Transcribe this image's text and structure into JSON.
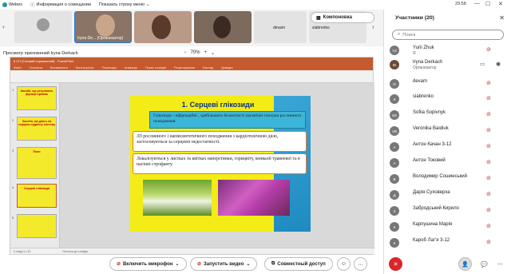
{
  "app": {
    "name": "Webex",
    "info_label": "Информация о совещании",
    "ticker_label": "Показать строку меню",
    "time": "29:58"
  },
  "strip": {
    "tiles": [
      {
        "name": ""
      },
      {
        "name": "Iryna De... (Организатор)"
      },
      {
        "name": ""
      },
      {
        "name": ""
      },
      {
        "name": "devam"
      },
      {
        "name": "siabrenko"
      }
    ]
  },
  "viewer": {
    "title": "Просмотр приложений Iryna Derkach",
    "zoom": "70%",
    "layout_button": "Компоновка"
  },
  "ppt": {
    "window_title": "6 СП (Готовий нормальний) - PowerPoint",
    "tabs": [
      "Файл",
      "Основна",
      "Вставлення",
      "Конструктор",
      "Переходи",
      "Анімація",
      "Показ слайдів",
      "Рецензування",
      "Вигляд",
      "Довідка"
    ],
    "status_left": "Слайд 4 з 12",
    "status_notes": "Нотатки до слайда",
    "thumbs": [
      {
        "num": "1",
        "text": "Засоби, що регулюють функції органів"
      },
      {
        "num": "2",
        "text": "Засоби, які діють на серцево-судинну систему"
      },
      {
        "num": "3",
        "text": "План"
      },
      {
        "num": "4",
        "text": "Серцеві глікозиди"
      },
      {
        "num": "5",
        "text": ""
      }
    ],
    "slide": {
      "title": "1. Серцеві глікозиди",
      "box1": "Глікозиди – ефірподібні , здебільшого безазотисті органічні сполуки рослинного походження",
      "box2": "ЛЗ рослинного і напівсинтетичного походження з кардіотонічною дією, застосовуються за серцевої недостатності.",
      "box3": "Локалізуються у листках та квітках наперстянки, горицвіту, конвалії травневої та в насінні строфанту."
    }
  },
  "participants": {
    "title": "Участники (20)",
    "search_placeholder": "Поиск",
    "list": [
      {
        "initials": "YZ",
        "name": "Yurii Zhuk",
        "role": "Я"
      },
      {
        "initials": "ID",
        "name": "Iryna Derkach",
        "role": "Организатор"
      },
      {
        "initials": "D",
        "name": "devam",
        "role": ""
      },
      {
        "initials": "S",
        "name": "siabrenko",
        "role": ""
      },
      {
        "initials": "SS",
        "name": "Sofiia Sopivnyk",
        "role": ""
      },
      {
        "initials": "VB",
        "name": "Veronika Baidiuk",
        "role": ""
      },
      {
        "initials": "A",
        "name": "Антон Качан 3-12",
        "role": ""
      },
      {
        "initials": "A",
        "name": "Антон Токовий",
        "role": ""
      },
      {
        "initials": "В",
        "name": "Володимир Сошинський",
        "role": ""
      },
      {
        "initials": "Д",
        "name": "Дарія Суховерха",
        "role": ""
      },
      {
        "initials": "З",
        "name": "Забродський Кирило",
        "role": ""
      },
      {
        "initials": "К",
        "name": "Карпушина Марія",
        "role": ""
      },
      {
        "initials": "К",
        "name": "Кароб Лаг'я 3-12",
        "role": ""
      }
    ]
  },
  "controls": {
    "mic_label": "Включить микрофон",
    "video_label": "Запустить видео",
    "share_label": "Совместный доступ"
  },
  "colors": {
    "accent": "#c55a2f",
    "end_call": "#d9252c"
  }
}
